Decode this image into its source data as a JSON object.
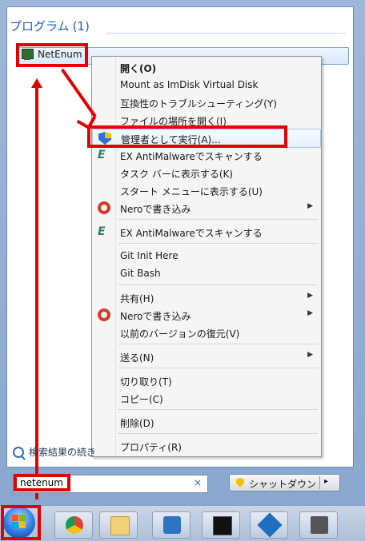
{
  "programs": {
    "title": "プログラム",
    "count": "(1)",
    "result": "NetEnum"
  },
  "context_menu": {
    "items": [
      "開く(O)",
      "Mount as ImDisk Virtual Disk",
      "互換性のトラブルシューティング(Y)",
      "ファイルの場所を開く(I)",
      "管理者として実行(A)...",
      "EX AntiMalwareでスキャンする",
      "タスク バーに表示する(K)",
      "スタート メニューに表示する(U)",
      "Neroで書き込み",
      "EX AntiMalwareでスキャンする",
      "Git Init Here",
      "Git Bash",
      "共有(H)",
      "Neroで書き込み",
      "以前のバージョンの復元(V)",
      "送る(N)",
      "切り取り(T)",
      "コピー(C)",
      "削除(D)",
      "プロパティ(R)"
    ]
  },
  "search": {
    "more_results": "検索結果の続き",
    "value": "netenum",
    "clear": "×"
  },
  "shutdown": {
    "label": "シャットダウン",
    "arrow": "▸"
  },
  "taskbar": {
    "apps": [
      "start-icon",
      "chrome-icon",
      "explorer-icon",
      "brackets-icon",
      "cmd-icon",
      "virtualbox-icon",
      "sublime-icon"
    ]
  },
  "colors": {
    "highlight_red": "#e00000",
    "title_blue": "#1e5fb4"
  },
  "icons": {
    "admin": "uac-shield-icon",
    "ex": "ex-antimalware-icon",
    "nero": "nero-icon",
    "submenu": "chevron-right-icon"
  }
}
